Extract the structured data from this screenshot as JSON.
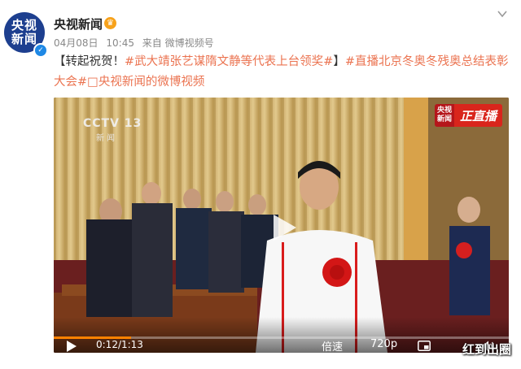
{
  "account": {
    "avatar_line1": "央视",
    "avatar_line2": "新闻",
    "name": "央视新闻",
    "verified_mark": "✓",
    "vip_mark": "♛"
  },
  "meta": {
    "date": "04月08日",
    "time": "10:45",
    "source": "来自 微博视频号"
  },
  "post": {
    "prefix": "【转起祝贺！",
    "tag1": "#武大靖张艺谋隋文静等代表上台领奖#",
    "mid": "】",
    "tag2": "#直播北京冬奥冬残奥总结表彰大会#",
    "link_icon": "□",
    "link_text": "央视新闻的微博视频"
  },
  "video": {
    "channel_logo": "CCTV 13",
    "channel_sub": "新闻",
    "live_left_1": "央视",
    "live_left_2": "新闻",
    "live_right": "正直播",
    "time_display": "0:12/1:13",
    "progress": 0.17,
    "speed_label": "倍速",
    "quality_label": "720p"
  },
  "watermark": "红到出圈",
  "icons": {
    "chevron": "chevron-down-icon",
    "play": "play-icon",
    "pip": "picture-in-picture-icon",
    "volume": "volume-icon"
  },
  "colors": {
    "tag": "#eb7350",
    "progress": "#ff8200",
    "avatar_bg": "#1d3f8f"
  }
}
